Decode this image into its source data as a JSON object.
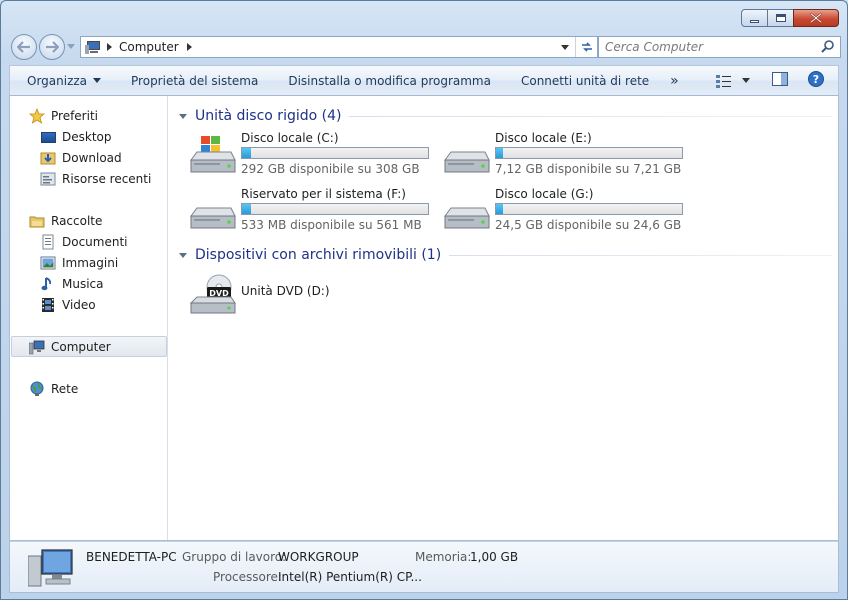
{
  "window": {
    "caption_buttons": [
      "minimize-icon",
      "maximize-icon",
      "close-icon"
    ]
  },
  "address_bar": {
    "location": "Computer"
  },
  "search": {
    "placeholder": "Cerca Computer"
  },
  "toolbar": {
    "organize": "Organizza",
    "system_properties": "Proprietà del sistema",
    "uninstall": "Disinstalla o modifica programma",
    "map_drive": "Connetti unità di rete",
    "more": "»"
  },
  "nav": {
    "favorites": "Preferiti",
    "desktop": "Desktop",
    "download": "Download",
    "recent": "Risorse recenti",
    "libraries": "Raccolte",
    "documents": "Documenti",
    "pictures": "Immagini",
    "music": "Musica",
    "video": "Video",
    "computer": "Computer",
    "network": "Rete"
  },
  "groups": {
    "hdd_title": "Unità disco rigido (4)",
    "removable_title": "Dispositivi con archivi rimovibili (1)"
  },
  "drives": [
    {
      "name": "Disco locale (C:)",
      "free": "292 GB disponibile su 308 GB",
      "used_fraction": 0.05,
      "icon": "windows-drive-icon"
    },
    {
      "name": "Disco locale (E:)",
      "free": "7,12 GB disponibile su 7,21 GB",
      "used_fraction": 0.01,
      "icon": "hard-drive-icon"
    },
    {
      "name": "Riservato per il sistema (F:)",
      "free": "533 MB disponibile su 561 MB",
      "used_fraction": 0.05,
      "icon": "hard-drive-icon"
    },
    {
      "name": "Disco locale (G:)",
      "free": "24,5 GB disponibile su 24,6 GB",
      "used_fraction": 0.004,
      "icon": "hard-drive-icon"
    }
  ],
  "dvd": {
    "name": "Unità DVD (D:)",
    "badge": "DVD"
  },
  "details": {
    "pc_name": "BENEDETTA-PC",
    "workgroup_label": "Gruppo di lavoro:",
    "workgroup_value": "WORKGROUP",
    "memory_label": "Memoria:",
    "memory_value": "1,00 GB",
    "processor_label": "Processore:",
    "processor_value": "Intel(R) Pentium(R) CP..."
  },
  "colors": {
    "accent_title": "#1e3287",
    "usage_fill": "#2a9ad8"
  }
}
